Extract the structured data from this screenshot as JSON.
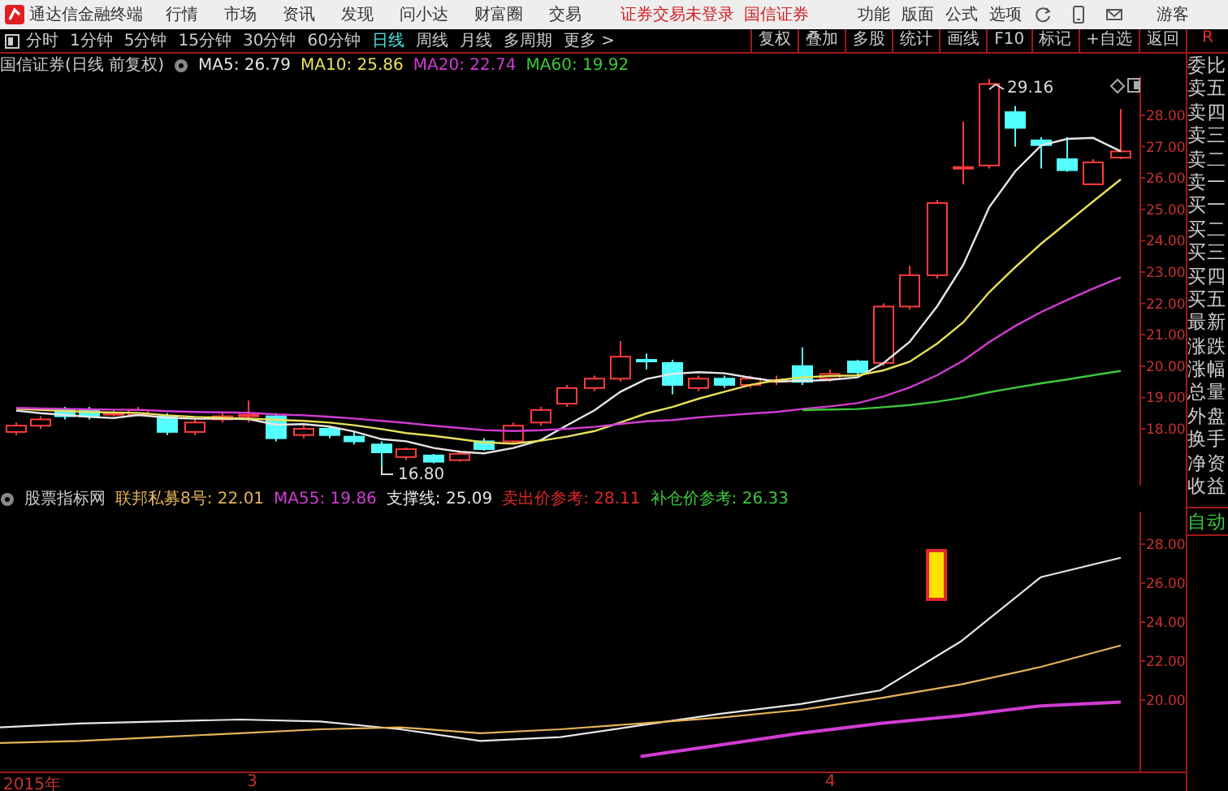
{
  "title_bar": {
    "app_name": "通达信金融终端",
    "menus": [
      "行情",
      "市场",
      "资讯",
      "发现",
      "问小达",
      "财富圈",
      "交易"
    ],
    "login_status": "证券交易未登录",
    "broker": "国信证券",
    "tools": [
      "功能",
      "版面",
      "公式",
      "选项"
    ],
    "user": "游客"
  },
  "period_bar": {
    "periods": [
      {
        "label": "分时",
        "selected": false
      },
      {
        "label": "1分钟",
        "selected": false
      },
      {
        "label": "5分钟",
        "selected": false
      },
      {
        "label": "15分钟",
        "selected": false
      },
      {
        "label": "30分钟",
        "selected": false
      },
      {
        "label": "60分钟",
        "selected": false
      },
      {
        "label": "日线",
        "selected": true
      },
      {
        "label": "周线",
        "selected": false
      },
      {
        "label": "月线",
        "selected": false
      },
      {
        "label": "多周期",
        "selected": false
      }
    ],
    "more": "更多 >"
  },
  "chart_tools": [
    "复权",
    "叠加",
    "多股",
    "统计",
    "画线",
    "F10",
    "标记",
    "+自选",
    "返回"
  ],
  "price_panel": {
    "title": "国信证券(日线 前复权)",
    "indicators": [
      {
        "label": "MA5: 26.79",
        "color": "#e6e6e6"
      },
      {
        "label": "MA10: 25.86",
        "color": "#e8e05a"
      },
      {
        "label": "MA20: 22.74",
        "color": "#d23cd2"
      },
      {
        "label": "MA60: 19.92",
        "color": "#3cc83c"
      }
    ],
    "y_ticks": [
      "28.00",
      "27.00",
      "26.00",
      "25.00",
      "24.00",
      "23.00",
      "22.00",
      "21.00",
      "20.00",
      "19.00",
      "18.00"
    ],
    "high_label": "29.16",
    "low_label": "16.80"
  },
  "quote_panel": {
    "corner_label": "R",
    "labels": [
      "委比",
      "卖五",
      "卖四",
      "卖三",
      "卖二",
      "卖一",
      "买一",
      "买二",
      "买三",
      "买四",
      "买五",
      "最新",
      "涨跌",
      "涨幅",
      "总量",
      "外盘",
      "换手",
      "净资",
      "收益"
    ],
    "auto_label": "自动"
  },
  "indicator_panel": {
    "title": "股票指标网",
    "indicators": [
      {
        "label": "联邦私募8号: 22.01",
        "color": "#e6b45a"
      },
      {
        "label": "MA55: 19.86",
        "color": "#d23cd2"
      },
      {
        "label": "支撑线: 25.09",
        "color": "#e6e6e6"
      },
      {
        "label": "卖出价参考: 28.11",
        "color": "#e02828"
      },
      {
        "label": "补仓价参考: 26.33",
        "color": "#3cc83c"
      }
    ],
    "chart_data": {
      "type": "line",
      "ylim": [
        16.33,
        29.67
      ],
      "yticks": [
        {
          "value": 28,
          "label": "28.00"
        },
        {
          "value": 26,
          "label": "26.00"
        },
        {
          "value": 24,
          "label": "24.00"
        },
        {
          "value": 22,
          "label": "22.00"
        },
        {
          "value": 20,
          "label": "20.00"
        }
      ],
      "series": [
        {
          "color": "#e6e6e6",
          "values": [
            18.6,
            18.8,
            18.9,
            19.0,
            18.9,
            18.5,
            17.9,
            18.1,
            18.7,
            19.3,
            19.8,
            20.5,
            23.0,
            26.3,
            27.3
          ]
        },
        {
          "color": "#e6b45a",
          "values": [
            17.8,
            17.9,
            18.1,
            18.3,
            18.5,
            18.6,
            18.3,
            18.5,
            18.8,
            19.1,
            19.5,
            20.1,
            20.8,
            21.7,
            22.8
          ]
        },
        {
          "color": "#d23cd2",
          "values": [
            null,
            null,
            null,
            null,
            null,
            null,
            null,
            null,
            17.1,
            17.7,
            18.3,
            18.8,
            19.2,
            19.7,
            19.9
          ]
        }
      ]
    }
  },
  "x_axis": [
    "2015年",
    "3",
    "4"
  ]
}
